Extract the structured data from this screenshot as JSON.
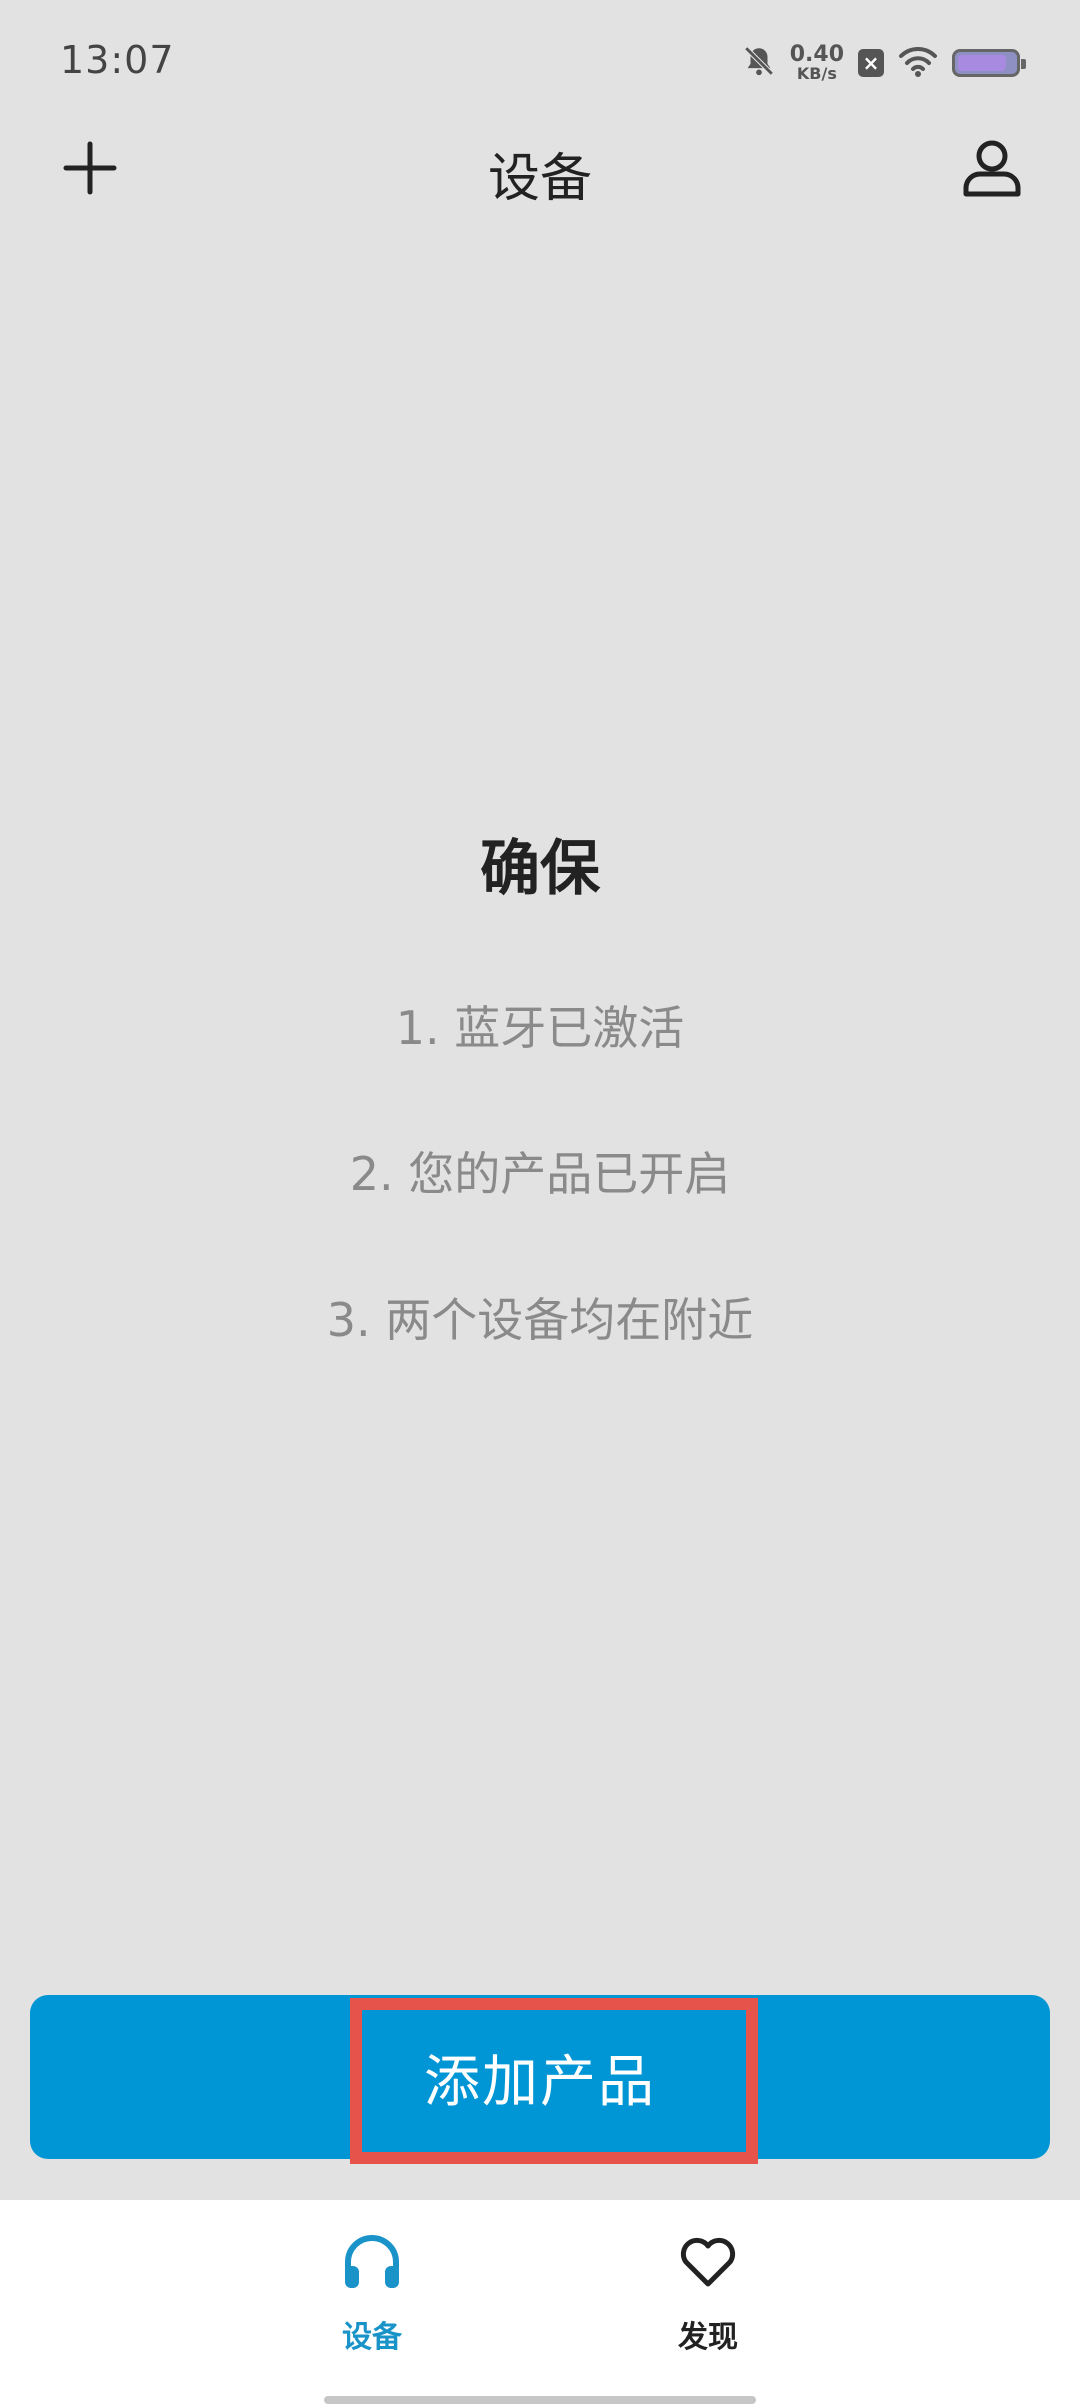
{
  "status_bar": {
    "time": "13:07",
    "net_speed_value": "0.40",
    "net_speed_unit": "KB/s",
    "badge_text": "×",
    "battery_level": 0.85,
    "icons": [
      "bell-muted-icon",
      "wifi-icon",
      "battery-icon"
    ]
  },
  "header": {
    "title": "设备",
    "left_icon": "plus-icon",
    "right_icon": "person-icon"
  },
  "instructions": {
    "heading": "确保",
    "items": [
      "1. 蓝牙已激活",
      "2. 您的产品已开启",
      "3. 两个设备均在附近"
    ]
  },
  "primary_action": {
    "label": "添加产品",
    "color": "#0096d6",
    "highlight_color": "#e5534b"
  },
  "bottom_nav": {
    "items": [
      {
        "label": "设备",
        "icon": "headphones-icon",
        "active": true,
        "color": "#1a93c9"
      },
      {
        "label": "发现",
        "icon": "heart-icon",
        "active": false,
        "color": "#222222"
      }
    ]
  }
}
